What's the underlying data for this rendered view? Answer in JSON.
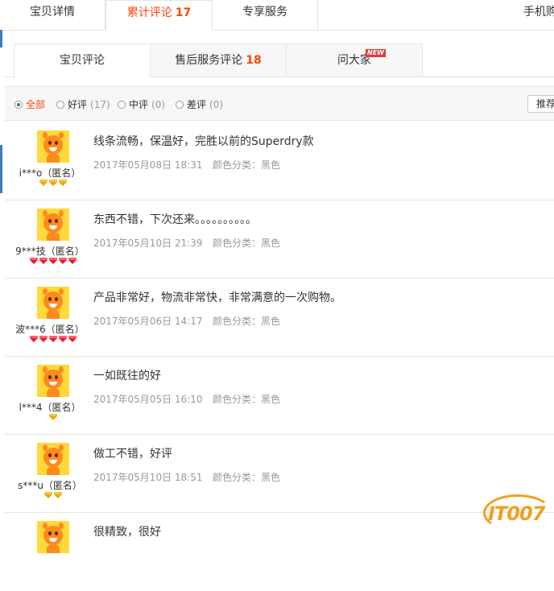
{
  "top_tabs": [
    {
      "label": "宝贝详情",
      "count": ""
    },
    {
      "label": "累计评论",
      "count": "17"
    },
    {
      "label": "专享服务",
      "count": ""
    },
    {
      "label": "手机购",
      "count": ""
    }
  ],
  "sub_tabs": [
    {
      "label": "宝贝评论",
      "count": ""
    },
    {
      "label": "售后服务评论",
      "count": "18"
    },
    {
      "label": "问大家",
      "count": "",
      "badge": "NEW"
    }
  ],
  "filters": [
    {
      "label": "全部",
      "count": ""
    },
    {
      "label": "好评",
      "count": "(17)"
    },
    {
      "label": "中评",
      "count": "(0)"
    },
    {
      "label": "差评",
      "count": "(0)"
    }
  ],
  "sort_label": "推荐",
  "reviews": [
    {
      "user": "i***o（匿名）",
      "content": "线条流畅，保温好，完胜以前的Superdry款",
      "date": "2017年05月08日 18:31",
      "sku": "颜色分类：黑色"
    },
    {
      "user": "9***技（匿名）",
      "content": "东西不错，下次还来。。。。。。。。。。",
      "date": "2017年05月10日 21:39",
      "sku": "颜色分类：黑色"
    },
    {
      "user": "波***6（匿名）",
      "content": "产品非常好，物流非常快，非常满意的一次购物。",
      "date": "2017年05月06日 14:17",
      "sku": "颜色分类：黑色"
    },
    {
      "user": "l***4（匿名）",
      "content": "一如既往的好",
      "date": "2017年05月05日 16:10",
      "sku": "颜色分类：黑色"
    },
    {
      "user": "s***u（匿名）",
      "content": "做工不错，好评",
      "date": "2017年05月10日 18:51",
      "sku": "颜色分类：黑色"
    },
    {
      "user": "",
      "content": "很精致，很好",
      "date": "",
      "sku": ""
    }
  ],
  "watermark": "IT007",
  "colors": {
    "accent": "#ff4400",
    "gold_gem": "#f2a400",
    "red_gem": "#e61e32"
  }
}
